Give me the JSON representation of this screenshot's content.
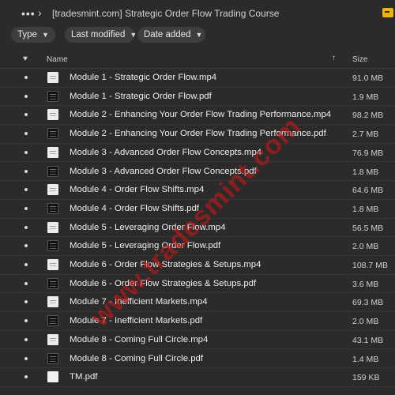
{
  "topbar": {
    "title": "[tradesmint.com] Strategic Order Flow Trading Course",
    "more_icon": "more-horizontal-icon",
    "breadcrumb_icon": "chevron-right-icon",
    "exit_icon": "exit-icon"
  },
  "filters": {
    "type_label": "Type",
    "modified_label": "Last modified",
    "added_label": "Date added"
  },
  "header": {
    "name_label": "Name",
    "size_label": "Size",
    "favorite_icon": "heart-icon",
    "sort_icon": "sort-up-icon"
  },
  "files": [
    {
      "name": "Module 1 - Strategic Order Flow.mp4",
      "size": "91.0 MB",
      "kind": "video"
    },
    {
      "name": "Module 1 - Strategic Order Flow.pdf",
      "size": "1.9 MB",
      "kind": "pdf"
    },
    {
      "name": "Module 2 - Enhancing Your Order Flow Trading Performance.mp4",
      "size": "98.2 MB",
      "kind": "video"
    },
    {
      "name": "Module 2 - Enhancing Your Order Flow Trading Performance.pdf",
      "size": "2.7 MB",
      "kind": "pdf"
    },
    {
      "name": "Module 3 - Advanced Order Flow Concepts.mp4",
      "size": "76.9 MB",
      "kind": "video"
    },
    {
      "name": "Module 3 - Advanced Order Flow Concepts.pdf",
      "size": "1.8 MB",
      "kind": "pdf"
    },
    {
      "name": "Module 4 - Order Flow Shifts.mp4",
      "size": "64.6 MB",
      "kind": "video"
    },
    {
      "name": "Module 4 - Order Flow Shifts.pdf",
      "size": "1.8 MB",
      "kind": "pdf"
    },
    {
      "name": "Module 5 - Leveraging Order Flow.mp4",
      "size": "56.5 MB",
      "kind": "video"
    },
    {
      "name": "Module 5 - Leveraging Order Flow.pdf",
      "size": "2.0 MB",
      "kind": "pdf"
    },
    {
      "name": "Module 6 - Order Flow Strategies & Setups.mp4",
      "size": "108.7 MB",
      "kind": "video"
    },
    {
      "name": "Module 6 - Order Flow Strategies & Setups.pdf",
      "size": "3.6 MB",
      "kind": "pdf"
    },
    {
      "name": "Module 7 - Inefficient Markets.mp4",
      "size": "69.3 MB",
      "kind": "video"
    },
    {
      "name": "Module 7 - Inefficient Markets.pdf",
      "size": "2.0 MB",
      "kind": "pdf"
    },
    {
      "name": "Module 8 - Coming Full Circle.mp4",
      "size": "43.1 MB",
      "kind": "video"
    },
    {
      "name": "Module 8 - Coming Full Circle.pdf",
      "size": "1.4 MB",
      "kind": "pdf"
    },
    {
      "name": "TM.pdf",
      "size": "159 KB",
      "kind": "plain"
    }
  ],
  "watermark": "www.tradesmint.com",
  "colors": {
    "background": "#2b2b2b",
    "chip": "#3e3e3e",
    "accent": "#f0b400",
    "watermark": "#dc1414"
  }
}
